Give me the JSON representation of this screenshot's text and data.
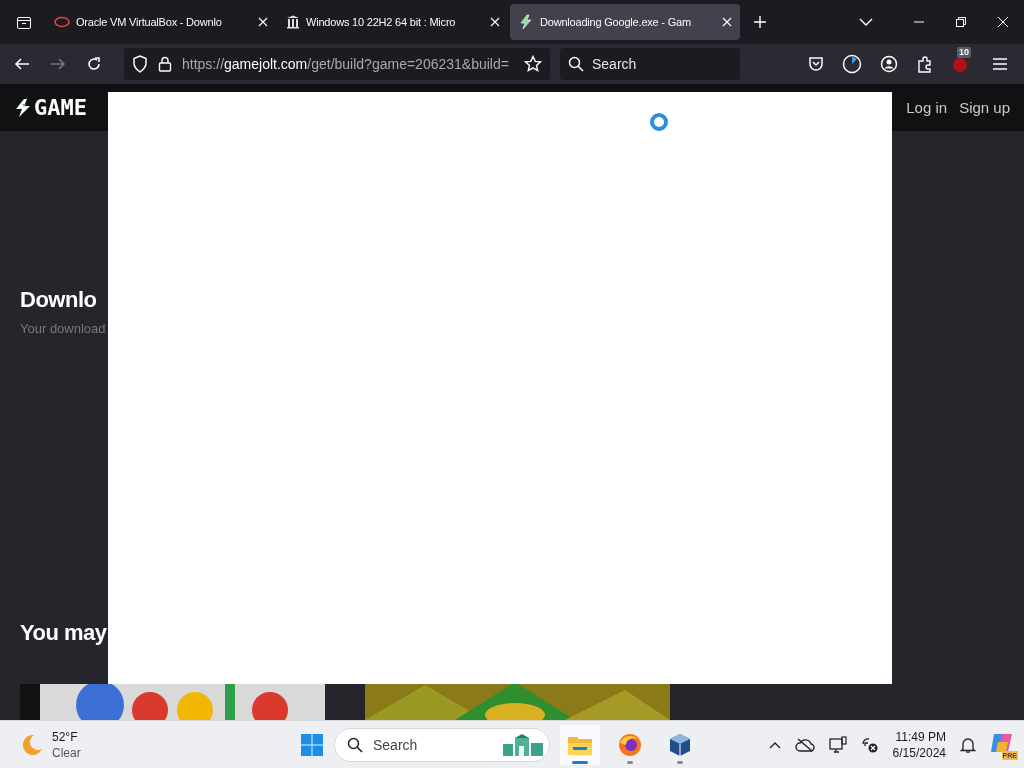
{
  "tabs": [
    {
      "kind": "oracle",
      "title": "Oracle VM VirtualBox - Downlo",
      "selected": false
    },
    {
      "kind": "archive",
      "title": "Windows 10 22H2 64 bit : Micro",
      "selected": false
    },
    {
      "kind": "bolt",
      "title": "Downloading Google.exe - Gam",
      "selected": true
    }
  ],
  "address": {
    "scheme": "https://",
    "host": "gamejolt.com",
    "path": "/get/build?game=206231&build="
  },
  "search": {
    "placeholder": "Search"
  },
  "extension_badge": "10",
  "site": {
    "logo": "GAME",
    "nav": [
      "Log in",
      "Sign up"
    ]
  },
  "page": {
    "heading": "Downlo",
    "subtitle": "Your download",
    "section": "You may"
  },
  "taskbar": {
    "temperature": "52°F",
    "condition": "Clear",
    "search_placeholder": "Search",
    "apps": [
      {
        "kind": "explorer",
        "selected": true
      },
      {
        "kind": "firefox",
        "selected": false
      },
      {
        "kind": "virtualbox",
        "selected": false
      }
    ],
    "time": "11:49 PM",
    "date": "6/15/2024",
    "copilot_badge": "PRE"
  }
}
